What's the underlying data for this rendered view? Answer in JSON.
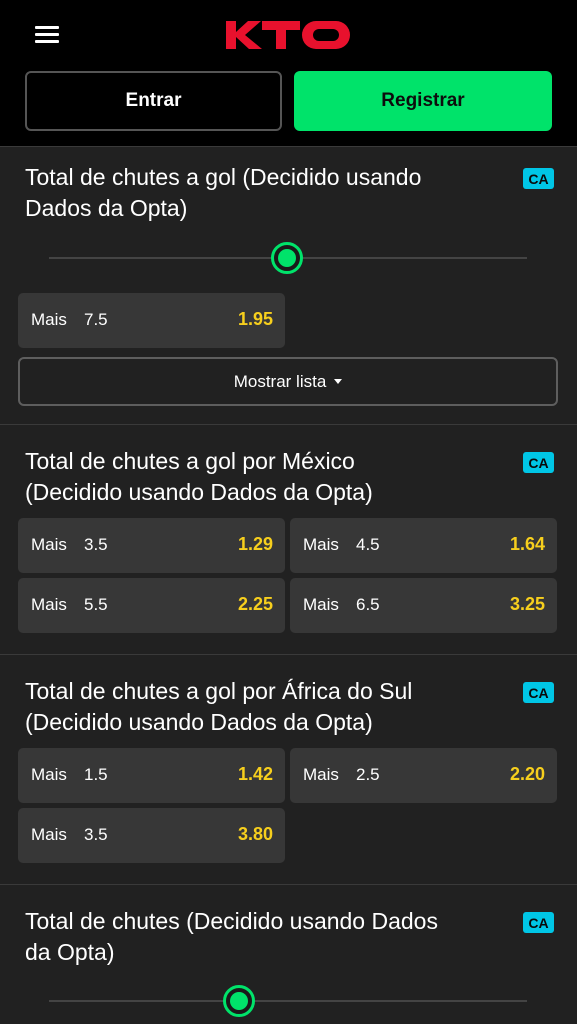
{
  "header": {
    "logo_text": "KTO",
    "logo_color": "#e8112d",
    "login_label": "Entrar",
    "register_label": "Registrar",
    "register_color": "#00e36a"
  },
  "colors": {
    "price": "#f7cf1d",
    "badge": "#00c6e6",
    "slider_accent": "#00e36a"
  },
  "markets": [
    {
      "title_line1": "Total de chutes a gol (Decidido usando",
      "title_line2": "Dados da Opta)",
      "badge": "CA",
      "has_slider": true,
      "outcomes": [
        {
          "label": "Mais",
          "line": "7.5",
          "price": "1.95"
        }
      ],
      "show_list_label": "Mostrar lista"
    },
    {
      "title_line1": "Total de chutes a gol por México",
      "title_line2": "(Decidido usando Dados da Opta)",
      "badge": "CA",
      "outcomes": [
        {
          "label": "Mais",
          "line": "3.5",
          "price": "1.29"
        },
        {
          "label": "Mais",
          "line": "4.5",
          "price": "1.64"
        },
        {
          "label": "Mais",
          "line": "5.5",
          "price": "2.25"
        },
        {
          "label": "Mais",
          "line": "6.5",
          "price": "3.25"
        }
      ]
    },
    {
      "title_line1": "Total de chutes a gol por África do Sul",
      "title_line2": "(Decidido usando Dados da Opta)",
      "badge": "CA",
      "outcomes": [
        {
          "label": "Mais",
          "line": "1.5",
          "price": "1.42"
        },
        {
          "label": "Mais",
          "line": "2.5",
          "price": "2.20"
        },
        {
          "label": "Mais",
          "line": "3.5",
          "price": "3.80"
        }
      ]
    },
    {
      "title_line1": "Total de chutes (Decidido usando Dados",
      "title_line2": "da Opta)",
      "badge": "CA",
      "has_slider": true
    }
  ]
}
